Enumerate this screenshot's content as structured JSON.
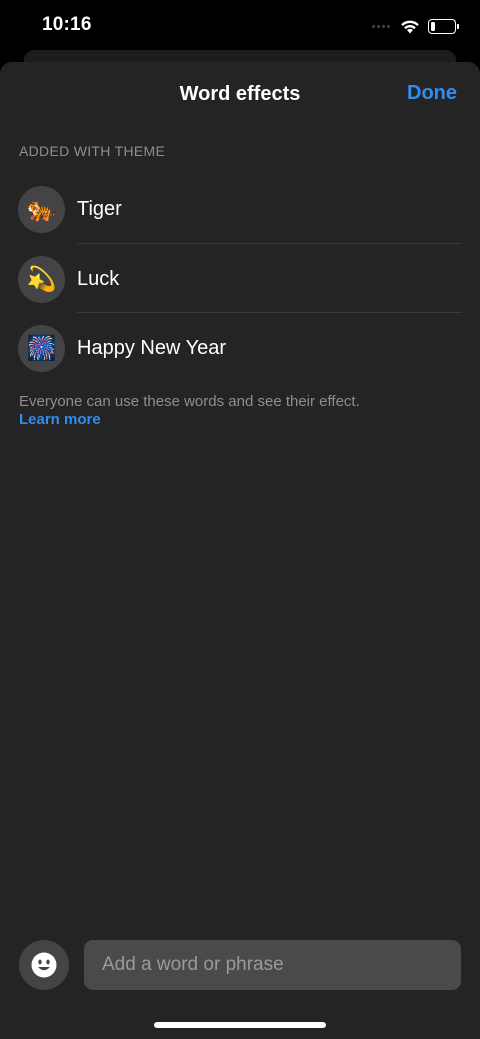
{
  "status": {
    "time": "10:16",
    "battery_level": 0.2
  },
  "sheet": {
    "title": "Word effects",
    "done_label": "Done",
    "section_header": "ADDED WITH THEME",
    "effects": [
      {
        "label": "Tiger",
        "icon": "tiger-icon",
        "emoji": "🐅"
      },
      {
        "label": "Luck",
        "icon": "dizzy-star-icon",
        "emoji": "💫"
      },
      {
        "label": "Happy New Year",
        "icon": "fireworks-icon",
        "emoji": "🎆"
      }
    ],
    "footer_note": "Everyone can use these words and see their effect.",
    "learn_more_label": "Learn more"
  },
  "composer": {
    "placeholder": "Add a word or phrase",
    "value": "",
    "emoji_icon": "smiley-face-icon"
  },
  "colors": {
    "accent": "#2f8ef3",
    "sheet_background": "#242424",
    "secondary_text": "#8e8e93"
  }
}
